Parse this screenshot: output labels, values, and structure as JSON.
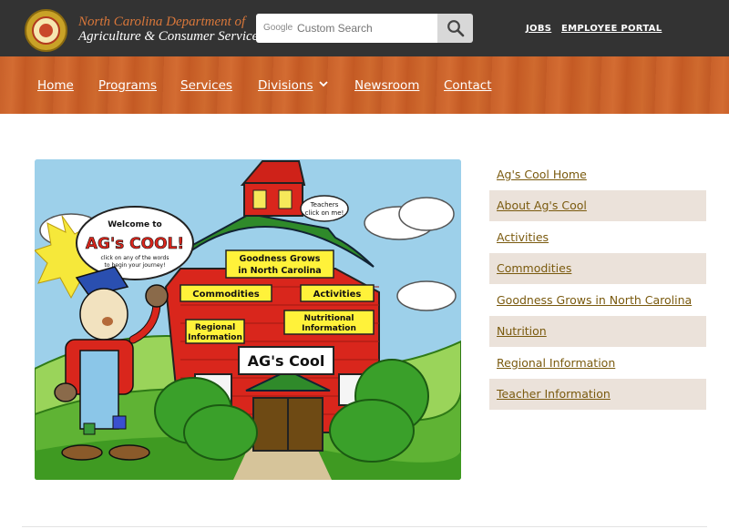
{
  "header": {
    "brand_line1": "North Carolina Department of",
    "brand_line2": "Agriculture & Consumer Services",
    "search": {
      "placeholder": "Custom Search",
      "provider_tag": "Google"
    },
    "top_links": [
      "JOBS",
      "EMPLOYEE PORTAL"
    ]
  },
  "nav": {
    "items": [
      "Home",
      "Programs",
      "Services",
      "Divisions",
      "Newsroom",
      "Contact"
    ]
  },
  "hero": {
    "welcome_title": "Welcome to",
    "welcome_big": "AG's COOL!",
    "welcome_sub": "click on any of the words to begin your journey!",
    "teachers_bubble": "Teachers click on me!",
    "signs": [
      "Goodness Grows in North Carolina",
      "Commodities",
      "Activities",
      "Regional Information",
      "Nutritional Information",
      "AG's Cool"
    ]
  },
  "sidebar": {
    "items": [
      "Ag's Cool Home",
      "About Ag's Cool",
      "Activities",
      "Commodities",
      "Goodness Grows in North Carolina",
      "Nutrition",
      "Regional Information",
      "Teacher Information"
    ]
  },
  "colors": {
    "topbar": "#333333",
    "nav_wood": "#c9612a",
    "link": "#7a5a0e",
    "sidebar_alt": "#ebe2da"
  }
}
